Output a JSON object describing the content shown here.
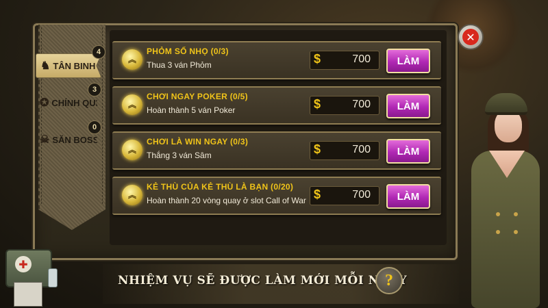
{
  "tabs": [
    {
      "label": "TÂN BINH",
      "badge": "4",
      "icon": "soldier-icon",
      "active": true
    },
    {
      "label": "CHÍNH QUI",
      "badge": "3",
      "icon": "star-rank-icon",
      "active": false
    },
    {
      "label": "SĂN BOSS",
      "badge": "0",
      "icon": "skull-icon",
      "active": false
    }
  ],
  "quests": [
    {
      "title": "PHỎM SỐ NHỌ (0/3)",
      "desc": "Thua 3 ván Phỏm",
      "reward": "700",
      "button": "LÀM"
    },
    {
      "title": "CHƠI NGAY POKER (0/5)",
      "desc": "Hoàn thành 5 ván Poker",
      "reward": "700",
      "button": "LÀM"
    },
    {
      "title": "CHƠI LÀ WIN NGAY (0/3)",
      "desc": "Thắng 3 ván Sâm",
      "reward": "700",
      "button": "LÀM"
    },
    {
      "title": "KẺ THÙ CỦA KẺ THÙ LÀ BẠN (0/20)",
      "desc": "Hoàn thành 20 vòng quay ở slot Call of War",
      "reward": "700",
      "button": "LÀM"
    }
  ],
  "currency_symbol": "$",
  "footer": {
    "note": "NHIỆM VỤ SẼ ĐƯỢC LÀM MỚI MỖI NGÀY",
    "help_symbol": "?"
  },
  "close_symbol": "✕",
  "colors": {
    "quest_title": "#f0c419",
    "do_button": "#b028b4",
    "close_button": "#d8281e"
  }
}
